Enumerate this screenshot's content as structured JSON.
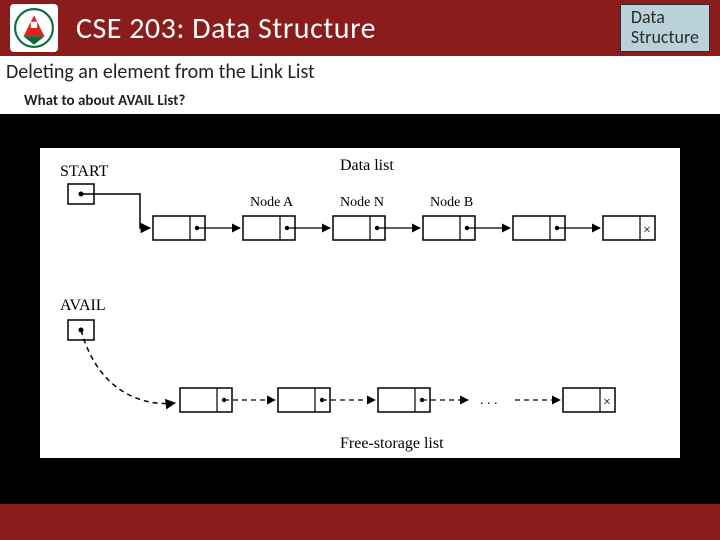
{
  "header": {
    "course_title": "CSE 203: Data Structure",
    "badge_line1": "Data",
    "badge_line2": "Structure"
  },
  "subtitle": "Deleting an element from the Link List",
  "question": "What to about AVAIL List?",
  "diagram": {
    "start_label": "START",
    "avail_label": "AVAIL",
    "data_list_label": "Data list",
    "node_a_label": "Node A",
    "node_n_label": "Node N",
    "node_b_label": "Node B",
    "free_list_label": "Free-storage list",
    "terminator": "×",
    "ellipsis": ". . ."
  }
}
